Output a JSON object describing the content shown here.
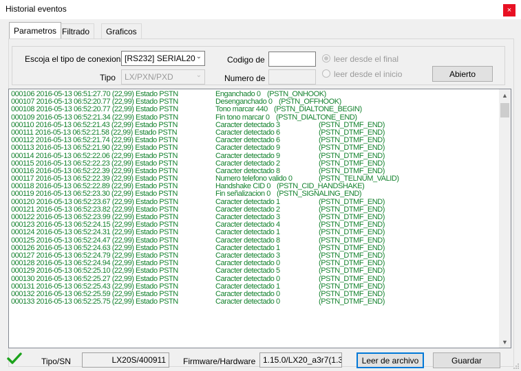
{
  "window": {
    "title": "Historial eventos",
    "close_glyph": "×"
  },
  "tabs": [
    {
      "label": "Parametros",
      "active": true
    },
    {
      "label": "Filtrado",
      "active": false
    },
    {
      "label": "Graficos",
      "active": false
    }
  ],
  "connection": {
    "type_label": "Escoja el tipo de conexion",
    "type_value": "[RS232] SERIAL20",
    "tipo_label": "Tipo",
    "tipo_value": "LX/PXN/PXD",
    "codigo_label": "Codigo de",
    "codigo_value": "",
    "numero_label": "Numero de",
    "numero_value": "",
    "radio_end_label": "leer desde el final",
    "radio_start_label": "leer desde el inicio",
    "open_button": "Abierto"
  },
  "log": {
    "lines": [
      {
        "head": "000106 2016-05-13 06:51:27.70 (22,99) Estado PSTN",
        "event": "Enganchado 0",
        "code": "(PSTN_ONHOOK)",
        "wide": false
      },
      {
        "head": "000107 2016-05-13 06:52:20.77 (22,99) Estado PSTN",
        "event": "Desenganchado 0",
        "code": "(PSTN_OFFHOOK)",
        "wide": false
      },
      {
        "head": "000108 2016-05-13 06:52:20.77 (22,99) Estado PSTN",
        "event": "Tono marcar 440",
        "code": "(PSTN_DIALTONE_BEGIN)",
        "wide": false
      },
      {
        "head": "000109 2016-05-13 06:52:21.34 (22,99) Estado PSTN",
        "event": "Fin tono marcar 0",
        "code": "(PSTN_DIALTONE_END)",
        "wide": false
      },
      {
        "head": "000110 2016-05-13 06:52:21.43 (22,99) Estado PSTN",
        "event": "Caracter detectado 3",
        "code": "(PSTN_DTMF_END)",
        "wide": true
      },
      {
        "head": "000111 2016-05-13 06:52:21.58 (22,99) Estado PSTN",
        "event": "Caracter detectado 6",
        "code": "(PSTN_DTMF_END)",
        "wide": true
      },
      {
        "head": "000112 2016-05-13 06:52:21.74 (22,99) Estado PSTN",
        "event": "Caracter detectado 6",
        "code": "(PSTN_DTMF_END)",
        "wide": true
      },
      {
        "head": "000113 2016-05-13 06:52:21.90 (22,99) Estado PSTN",
        "event": "Caracter detectado 9",
        "code": "(PSTN_DTMF_END)",
        "wide": true
      },
      {
        "head": "000114 2016-05-13 06:52:22.06 (22,99) Estado PSTN",
        "event": "Caracter detectado 9",
        "code": "(PSTN_DTMF_END)",
        "wide": true
      },
      {
        "head": "000115 2016-05-13 06:52:22.23 (22,99) Estado PSTN",
        "event": "Caracter detectado 2",
        "code": "(PSTN_DTMF_END)",
        "wide": true
      },
      {
        "head": "000116 2016-05-13 06:52:22.39 (22,99) Estado PSTN",
        "event": "Caracter detectado 8",
        "code": "(PSTN_DTMF_END)",
        "wide": true
      },
      {
        "head": "000117 2016-05-13 06:52:22.39 (22,99) Estado PSTN",
        "event": "Numero telefono valido 0",
        "code": "(PSTN_TELNUM_VALID)",
        "wide": true
      },
      {
        "head": "000118 2016-05-13 06:52:22.89 (22,99) Estado PSTN",
        "event": "Handshake CID 0",
        "code": "(PSTN_CID_HANDSHAKE)",
        "wide": false
      },
      {
        "head": "000119 2016-05-13 06:52:23.30 (22,99) Estado PSTN",
        "event": "Fin señalizacion 0",
        "code": "(PSTN_SIGNALING_END)",
        "wide": false
      },
      {
        "head": "000120 2016-05-13 06:52:23.67 (22,99) Estado PSTN",
        "event": "Caracter detectado 1",
        "code": "(PSTN_DTMF_END)",
        "wide": true
      },
      {
        "head": "000121 2016-05-13 06:52:23.82 (22,99) Estado PSTN",
        "event": "Caracter detectado 2",
        "code": "(PSTN_DTMF_END)",
        "wide": true
      },
      {
        "head": "000122 2016-05-13 06:52:23.99 (22,99) Estado PSTN",
        "event": "Caracter detectado 3",
        "code": "(PSTN_DTMF_END)",
        "wide": true
      },
      {
        "head": "000123 2016-05-13 06:52:24.15 (22,99) Estado PSTN",
        "event": "Caracter detectado 4",
        "code": "(PSTN_DTMF_END)",
        "wide": true
      },
      {
        "head": "000124 2016-05-13 06:52:24.31 (22,99) Estado PSTN",
        "event": "Caracter detectado 1",
        "code": "(PSTN_DTMF_END)",
        "wide": true
      },
      {
        "head": "000125 2016-05-13 06:52:24.47 (22,99) Estado PSTN",
        "event": "Caracter detectado 8",
        "code": "(PSTN_DTMF_END)",
        "wide": true
      },
      {
        "head": "000126 2016-05-13 06:52:24.63 (22,99) Estado PSTN",
        "event": "Caracter detectado 1",
        "code": "(PSTN_DTMF_END)",
        "wide": true
      },
      {
        "head": "000127 2016-05-13 06:52:24.79 (22,99) Estado PSTN",
        "event": "Caracter detectado 3",
        "code": "(PSTN_DTMF_END)",
        "wide": true
      },
      {
        "head": "000128 2016-05-13 06:52:24.94 (22,99) Estado PSTN",
        "event": "Caracter detectado 0",
        "code": "(PSTN_DTMF_END)",
        "wide": true
      },
      {
        "head": "000129 2016-05-13 06:52:25.10 (22,99) Estado PSTN",
        "event": "Caracter detectado 5",
        "code": "(PSTN_DTMF_END)",
        "wide": true
      },
      {
        "head": "000130 2016-05-13 06:52:25.27 (22,99) Estado PSTN",
        "event": "Caracter detectado 0",
        "code": "(PSTN_DTMF_END)",
        "wide": true
      },
      {
        "head": "000131 2016-05-13 06:52:25.43 (22,99) Estado PSTN",
        "event": "Caracter detectado 1",
        "code": "(PSTN_DTMF_END)",
        "wide": true
      },
      {
        "head": "000132 2016-05-13 06:52:25.59 (22,99) Estado PSTN",
        "event": "Caracter detectado 0",
        "code": "(PSTN_DTMF_END)",
        "wide": true
      },
      {
        "head": "000133 2016-05-13 06:52:25.75 (22,99) Estado PSTN",
        "event": "Caracter detectado 0",
        "code": "(PSTN_DTMF_END)",
        "wide": true
      }
    ]
  },
  "footer": {
    "tipo_sn_label": "Tipo/SN",
    "tipo_sn_value": "LX20S/400911",
    "firmware_label": "Firmware/Hardware",
    "firmware_value": "1.15.0/LX20_a3r7(1.3.",
    "read_file_button": "Leer de archivo",
    "save_button": "Guardar"
  },
  "colors": {
    "log_text": "#14822e",
    "status_ok": "#1ba21b",
    "close_red": "#e81123",
    "focus_blue": "#0078d7"
  },
  "icons": {
    "status": "check-icon",
    "close": "close-icon",
    "scroll_up": "chevron-up-icon",
    "scroll_down": "chevron-down-icon"
  }
}
